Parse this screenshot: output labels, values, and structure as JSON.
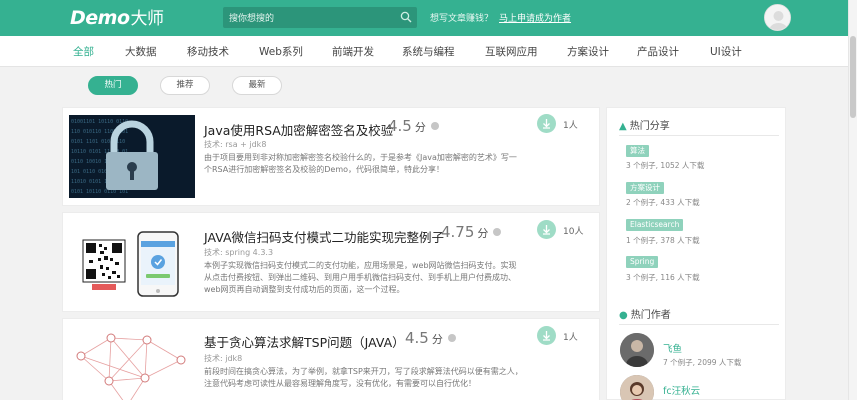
{
  "header": {
    "logo_text": "Demo",
    "logo_cn": "大师",
    "search_placeholder": "搜你想搜的",
    "question": "想写文章赚钱？",
    "question_link": "马上申请成为作者",
    "brand_color": "#35b191"
  },
  "nav": {
    "items": [
      {
        "label": "全部",
        "active": true
      },
      {
        "label": "大数据"
      },
      {
        "label": "移动技术"
      },
      {
        "label": "Web系列"
      },
      {
        "label": "前端开发"
      },
      {
        "label": "系统与编程"
      },
      {
        "label": "互联网应用"
      },
      {
        "label": "方案设计"
      },
      {
        "label": "产品设计"
      },
      {
        "label": "UI设计"
      }
    ]
  },
  "filters": [
    {
      "label": "热门",
      "active": true
    },
    {
      "label": "推荐"
    },
    {
      "label": "最新"
    }
  ],
  "articles": [
    {
      "title": "Java使用RSA加密解密签名及校验",
      "score": "4.5",
      "score_unit": "分",
      "tags": "技术: rsa + jdk8",
      "desc": "由于项目要用到非对称加密解密签名校验什么的，于是参考《Java加密解密的艺术》写一个RSA进行加密解密签名及校验的Demo，代码很简单，特此分享！",
      "downloads": "1人",
      "thumb": "lock-image"
    },
    {
      "title": "JAVA微信扫码支付模式二功能实现完整例子",
      "score": "4.75",
      "score_unit": "分",
      "tags": "技术: spring 4.3.3",
      "desc": "本例子实现微信扫码支付模式二的支付功能，应用场景是，web网站微信扫码支付。实现从点击付费按钮、到弹出二维码、到用户用手机微信扫码支付、到手机上用户付费成功、web网页再自动调整到支付成功后的页面，这一个过程。",
      "downloads": "10人",
      "thumb": "qr-payment-image"
    },
    {
      "title": "基于贪心算法求解TSP问题（JAVA）",
      "score": "4.5",
      "score_unit": "分",
      "tags": "技术: jdk8",
      "desc": "前段时间在搞贪心算法，为了举例，就拿TSP来开刀，写了段求解算法代码以便有需之人，注意代码考虑可读性从最容易理解角度写，没有优化，有需要可以自行优化！",
      "downloads": "1人",
      "thumb": "graph-image"
    }
  ],
  "sidebar": {
    "hot_share_title": "热门分享",
    "hot_share": [
      {
        "tag": "算法",
        "meta": "3 个例子, 1052 人下载"
      },
      {
        "tag": "方案设计",
        "meta": "2 个例子, 433 人下载"
      },
      {
        "tag": "Elasticsearch",
        "meta": "1 个例子, 378 人下载"
      },
      {
        "tag": "Spring",
        "meta": "3 个例子, 116 人下载"
      }
    ],
    "hot_author_title": "热门作者",
    "hot_authors": [
      {
        "name": "飞鱼",
        "meta": "7 个例子, 2099 人下载"
      },
      {
        "name": "fc汪秋云",
        "meta": ""
      }
    ]
  }
}
